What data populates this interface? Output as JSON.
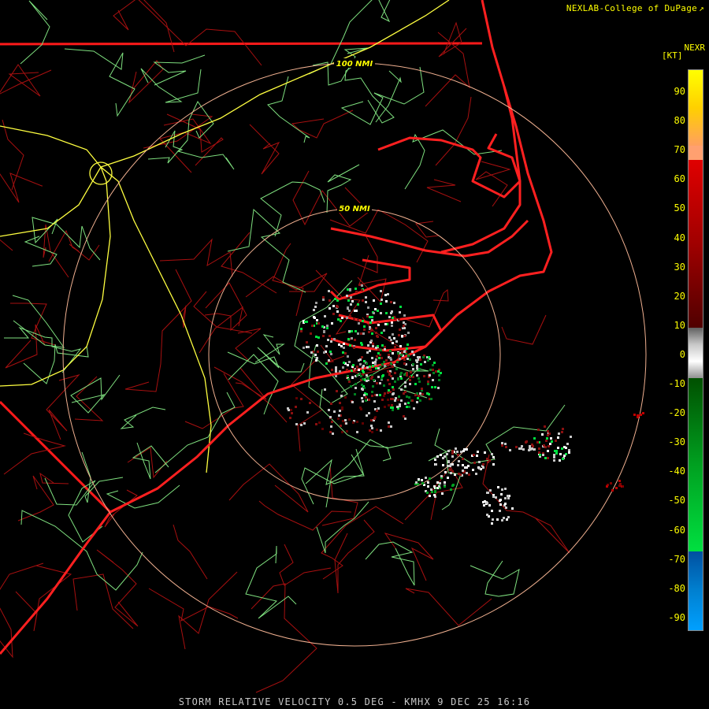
{
  "credit_text": "NEXLAB-College of DuPage",
  "product_label": "STORM RELATIVE VELOCITY 0.5 DEG - KMHX 9 DEC 25 16:16",
  "range_rings": [
    {
      "label": "50 NMI"
    },
    {
      "label": "100 NMI"
    }
  ],
  "color_scale": {
    "title": "NEXR",
    "unit": "[KT]",
    "ticks": [
      "90",
      "80",
      "70",
      "60",
      "50",
      "40",
      "30",
      "20",
      "10",
      "0",
      "-10",
      "-20",
      "-30",
      "-40",
      "-50",
      "-60",
      "-70",
      "-80",
      "-90"
    ],
    "colors": {
      "inbound_strong": "#00a0ff",
      "inbound": "#00e040",
      "near_zero": "#c8c8c8",
      "outbound": "#e00000",
      "outbound_strong": "#ffff00"
    }
  },
  "map_colors": {
    "coastline": "#ff1a1a",
    "county_lines": "#b01010",
    "highways": "#80ff80",
    "interstates": "#ffff40",
    "rings": "#f0b090"
  }
}
